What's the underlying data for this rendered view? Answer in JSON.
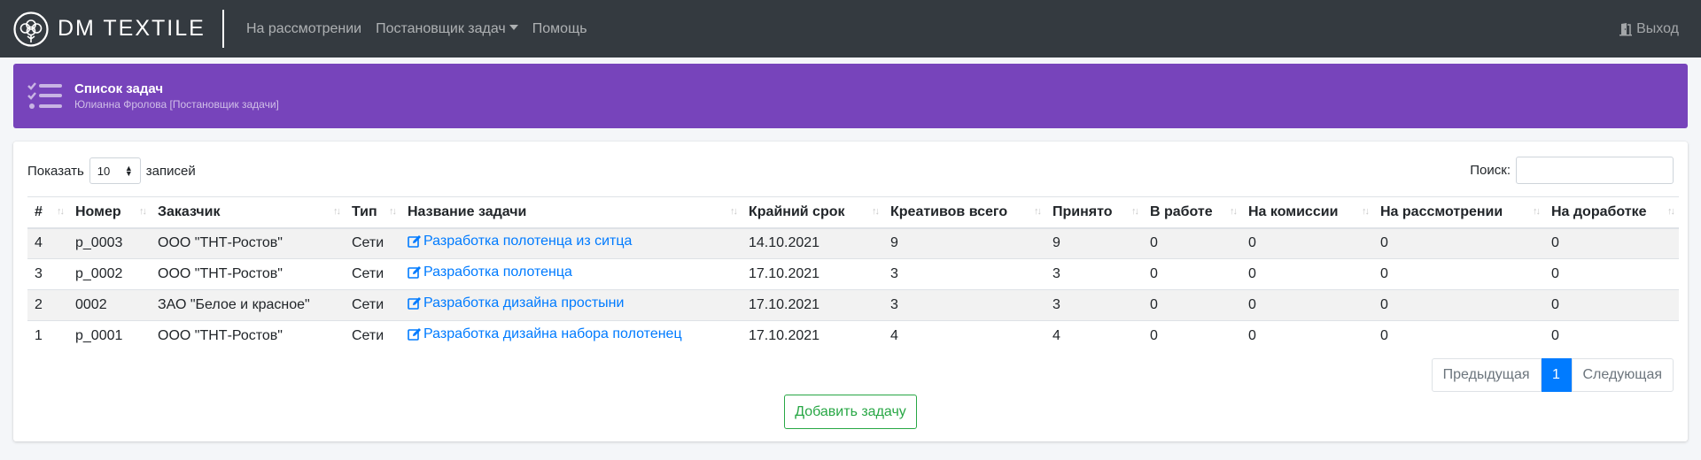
{
  "brand": {
    "name": "DM TEXTILE"
  },
  "nav": {
    "items": [
      {
        "label": "На рассмотрении"
      },
      {
        "label": "Постановщик задач"
      },
      {
        "label": "Помощь"
      }
    ],
    "logout_label": "Выход"
  },
  "header": {
    "title": "Список задач",
    "subtitle": "Юлианна Фролова [Постановщик задачи]"
  },
  "controls": {
    "show_label": "Показать",
    "page_size": "10",
    "entries_label": "записей",
    "search_label": "Поиск:",
    "search_value": ""
  },
  "table": {
    "columns": [
      "#",
      "Номер",
      "Заказчик",
      "Тип",
      "Название задачи",
      "Крайний срок",
      "Креативов всего",
      "Принято",
      "В работе",
      "На комиссии",
      "На рассмотрении",
      "На доработке"
    ],
    "rows": [
      [
        "4",
        "p_0003",
        "ООО \"ТНТ-Ростов\"",
        "Сети",
        "Разработка полотенца из ситца",
        "14.10.2021",
        "9",
        "9",
        "0",
        "0",
        "0",
        "0"
      ],
      [
        "3",
        "p_0002",
        "ООО \"ТНТ-Ростов\"",
        "Сети",
        "Разработка полотенца",
        "17.10.2021",
        "3",
        "3",
        "0",
        "0",
        "0",
        "0"
      ],
      [
        "2",
        "0002",
        "ЗАО \"Белое и красное\"",
        "Сети",
        "Разработка дизайна простыни",
        "17.10.2021",
        "3",
        "3",
        "0",
        "0",
        "0",
        "0"
      ],
      [
        "1",
        "p_0001",
        "ООО \"ТНТ-Ростов\"",
        "Сети",
        "Разработка дизайна набора полотенец",
        "17.10.2021",
        "4",
        "4",
        "0",
        "0",
        "0",
        "0"
      ]
    ]
  },
  "pagination": {
    "prev_label": "Предыдущая",
    "current_page": "1",
    "next_label": "Следующая"
  },
  "add_button_label": "Добавить задачу",
  "colors": {
    "navbar": "#343a40",
    "header": "#7744bb",
    "link": "#007bff",
    "add_button": "#28a745"
  },
  "icons": {
    "logo": "cotton-flower-icon",
    "header": "tasks-list-icon",
    "logout": "door-exit-icon",
    "task_link": "edit-icon"
  }
}
